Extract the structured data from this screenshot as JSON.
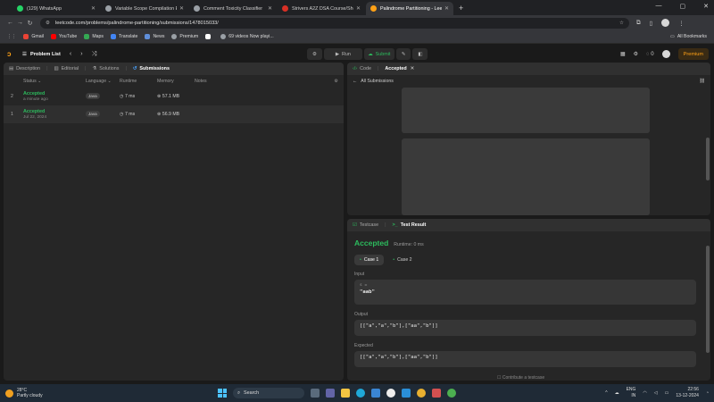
{
  "browser": {
    "tabs": [
      {
        "title": "(129) WhatsApp",
        "color": "#25d366",
        "active": false
      },
      {
        "title": "Variable Scope Compilation Er...",
        "color": "#9aa0a6",
        "active": false
      },
      {
        "title": "Comment Toxicity Classifier",
        "color": "#9aa0a6",
        "active": false
      },
      {
        "title": "Strivers A2Z DSA Course/Sheet",
        "color": "#d93025",
        "active": false
      },
      {
        "title": "Palindrome Partitioning - Leet...",
        "color": "#ffa116",
        "active": true
      }
    ],
    "url": "leetcode.com/problems/palindrome-partitioning/submissions/1478015033/",
    "avatar": "",
    "bookmarks": [
      {
        "label": "Gmail",
        "color": "#ea4335"
      },
      {
        "label": "YouTube",
        "color": "#ff0000"
      },
      {
        "label": "Maps",
        "color": "#34a853"
      },
      {
        "label": "Translate",
        "color": "#4285f4"
      },
      {
        "label": "News",
        "color": "#5f8fdb"
      },
      {
        "label": "Premium",
        "color": "#9aa0a6"
      },
      {
        "label": "",
        "color": "#ffffff"
      },
      {
        "label": "69 videos Now playi...",
        "color": "#9aa0a6"
      }
    ],
    "all_bookmarks": "All Bookmarks"
  },
  "leetcode": {
    "problem_list": "Problem List",
    "run": "Run",
    "submit": "Submit",
    "streak": "0",
    "premium": "Premium",
    "left_tabs": [
      "Description",
      "Editorial",
      "Solutions",
      "Submissions"
    ],
    "columns": [
      "Status",
      "Language",
      "Runtime",
      "Memory",
      "Notes"
    ],
    "submissions": [
      {
        "index": "2",
        "status": "Accepted",
        "date": "a minute ago",
        "lang": "Java",
        "runtime": "7 ms",
        "memory": "57.1 MB"
      },
      {
        "index": "1",
        "status": "Accepted",
        "date": "Jul 22, 2024",
        "lang": "Java",
        "runtime": "7 ms",
        "memory": "56.9 MB"
      }
    ],
    "code_tab": "Code",
    "accepted_tab": "Accepted",
    "all_submissions": "All Submissions",
    "testcase_tab": "Testcase",
    "result_tab": "Test Result",
    "result": "Accepted",
    "runtime_text": "Runtime: 0 ms",
    "cases": [
      "Case 1",
      "Case 2"
    ],
    "input_label": "Input",
    "input_var": "s =",
    "input_value": "\"aab\"",
    "output_label": "Output",
    "output_value": "[[\"a\",\"a\",\"b\"],[\"aa\",\"b\"]]",
    "expected_label": "Expected",
    "expected_value": "[[\"a\",\"a\",\"b\"],[\"aa\",\"b\"]]",
    "contribute": "Contribute a testcase"
  },
  "taskbar": {
    "temp": "28°C",
    "weather": "Partly cloudy",
    "search": "Search",
    "lang": "ENG",
    "region": "IN",
    "time": "22:56",
    "date": "13-12-2024"
  }
}
